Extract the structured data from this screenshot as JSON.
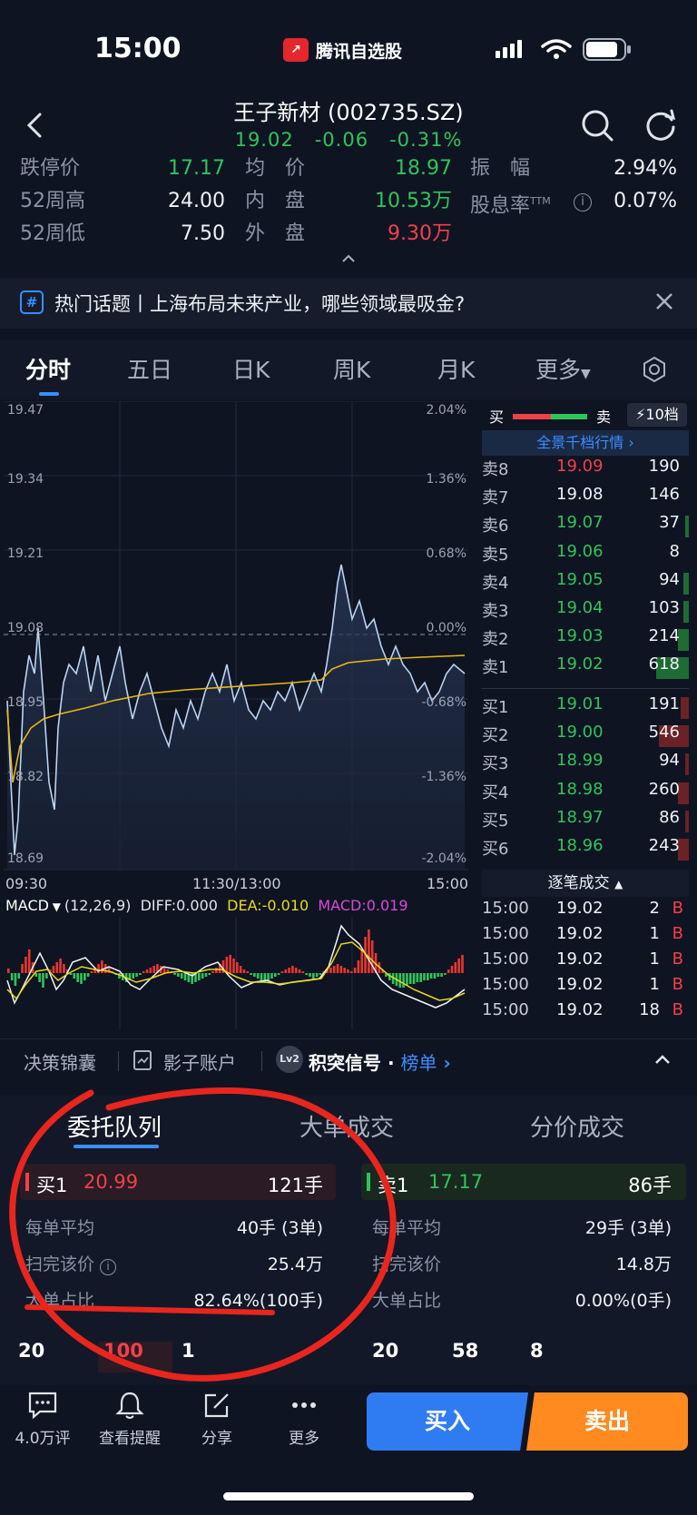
{
  "status_bar": {
    "time": "15:00",
    "app_name": "腾讯自选股"
  },
  "header": {
    "title": "王子新材 (002735.SZ)",
    "price": "19.02",
    "change": "-0.06",
    "change_pct": "-0.31%"
  },
  "stats": [
    {
      "label": "跌停价",
      "value": "17.17",
      "color": "green"
    },
    {
      "label": "52周高",
      "value": "24.00",
      "color": "white"
    },
    {
      "label": "52周低",
      "value": "7.50",
      "color": "white"
    },
    {
      "label": "均　价",
      "value": "18.97",
      "color": "green"
    },
    {
      "label": "内　盘",
      "value": "10.53万",
      "color": "green"
    },
    {
      "label": "外　盘",
      "value": "9.30万",
      "color": "red"
    },
    {
      "label": "振　幅",
      "value": "2.94%",
      "color": "white"
    },
    {
      "label": "股息率",
      "label_sup": "TTM",
      "value": "0.07%",
      "color": "white"
    }
  ],
  "banner": {
    "icon": "#",
    "text": "热门话题丨上海布局未来产业，哪些领域最吸金?"
  },
  "chart_tabs": [
    "分时",
    "五日",
    "日K",
    "周K",
    "月K",
    "更多"
  ],
  "chart": {
    "left_axis": [
      "19.47",
      "19.34",
      "19.21",
      "19.08",
      "18.95",
      "18.82",
      "18.69"
    ],
    "right_axis": [
      "2.04%",
      "1.36%",
      "0.68%",
      "0.00%",
      "-0.68%",
      "-1.36%",
      "-2.04%"
    ],
    "time_labels": [
      "09:30",
      "11:30/13:00",
      "15:00"
    ],
    "macd": {
      "name": "MACD",
      "params": "(12,26,9)",
      "diff": "DIFF:0.000",
      "dea": "DEA:-0.010",
      "macd": "MACD:0.019"
    }
  },
  "orderbook": {
    "buy_label": "买",
    "sell_label": "卖",
    "levels_btn": "10档",
    "full_link": "全景千档行情 ›",
    "asks": [
      {
        "label": "卖8",
        "price": "19.09",
        "vol": "190",
        "color": "red",
        "share": 0.0
      },
      {
        "label": "卖7",
        "price": "19.08",
        "vol": "146",
        "color": "white",
        "share": 0.0
      },
      {
        "label": "卖6",
        "price": "19.07",
        "vol": "37",
        "color": "green",
        "share": 0.05
      },
      {
        "label": "卖5",
        "price": "19.06",
        "vol": "8",
        "color": "green",
        "share": 0.0
      },
      {
        "label": "卖4",
        "price": "19.05",
        "vol": "94",
        "color": "green",
        "share": 0.1
      },
      {
        "label": "卖3",
        "price": "19.04",
        "vol": "103",
        "color": "green",
        "share": 0.1
      },
      {
        "label": "卖2",
        "price": "19.03",
        "vol": "214",
        "color": "green",
        "share": 0.2
      },
      {
        "label": "卖1",
        "price": "19.02",
        "vol": "618",
        "color": "green",
        "share": 0.6
      }
    ],
    "bids": [
      {
        "label": "买1",
        "price": "19.01",
        "vol": "191",
        "color": "green",
        "share": 0.15
      },
      {
        "label": "买2",
        "price": "19.00",
        "vol": "546",
        "color": "green",
        "share": 0.55
      },
      {
        "label": "买3",
        "price": "18.99",
        "vol": "94",
        "color": "green",
        "share": 0.05
      },
      {
        "label": "买4",
        "price": "18.98",
        "vol": "260",
        "color": "green",
        "share": 0.2
      },
      {
        "label": "买5",
        "price": "18.97",
        "vol": "86",
        "color": "green",
        "share": 0.05
      },
      {
        "label": "买6",
        "price": "18.96",
        "vol": "243",
        "color": "green",
        "share": 0.2
      }
    ],
    "ticks_title": "逐笔成交",
    "ticks": [
      {
        "time": "15:00",
        "price": "19.02",
        "vol": "2",
        "side": "B"
      },
      {
        "time": "15:00",
        "price": "19.02",
        "vol": "1",
        "side": "B"
      },
      {
        "time": "15:00",
        "price": "19.02",
        "vol": "1",
        "side": "B"
      },
      {
        "time": "15:00",
        "price": "19.02",
        "vol": "1",
        "side": "B"
      },
      {
        "time": "15:00",
        "price": "19.02",
        "vol": "18",
        "side": "B"
      }
    ]
  },
  "tools": {
    "decision": "决策锦囊",
    "shadow": "影子账户",
    "signal_badge": "Lv2",
    "signal": "积突信号",
    "rank": "榜单"
  },
  "segments": [
    "委托队列",
    "大单成交",
    "分价成交"
  ],
  "queue": {
    "buy": {
      "label": "买1",
      "price": "20.99",
      "qty": "121手",
      "rows": [
        {
          "k": "每单平均",
          "v": "40手 (3单)"
        },
        {
          "k": "扫完该价",
          "v": "25.4万"
        },
        {
          "k": "大单占比",
          "v": "82.64%(100手)"
        }
      ],
      "orders": [
        "20",
        "100",
        "1"
      ]
    },
    "sell": {
      "label": "卖1",
      "price": "17.17",
      "qty": "86手",
      "rows": [
        {
          "k": "每单平均",
          "v": "29手 (3单)"
        },
        {
          "k": "扫完该价",
          "v": "14.8万"
        },
        {
          "k": "大单占比",
          "v": "0.00%(0手)"
        }
      ],
      "orders": [
        "20",
        "58",
        "8"
      ]
    }
  },
  "bottom_nav": {
    "comments": "4.0万评",
    "alert": "查看提醒",
    "share": "分享",
    "more": "更多",
    "buy": "买入",
    "sell": "卖出"
  },
  "colors": {
    "up": "#f0414a",
    "down": "#2fc45a",
    "accent": "#3a8eff",
    "buy_btn": "#2f7cf2",
    "sell_btn": "#ff8a1f"
  }
}
